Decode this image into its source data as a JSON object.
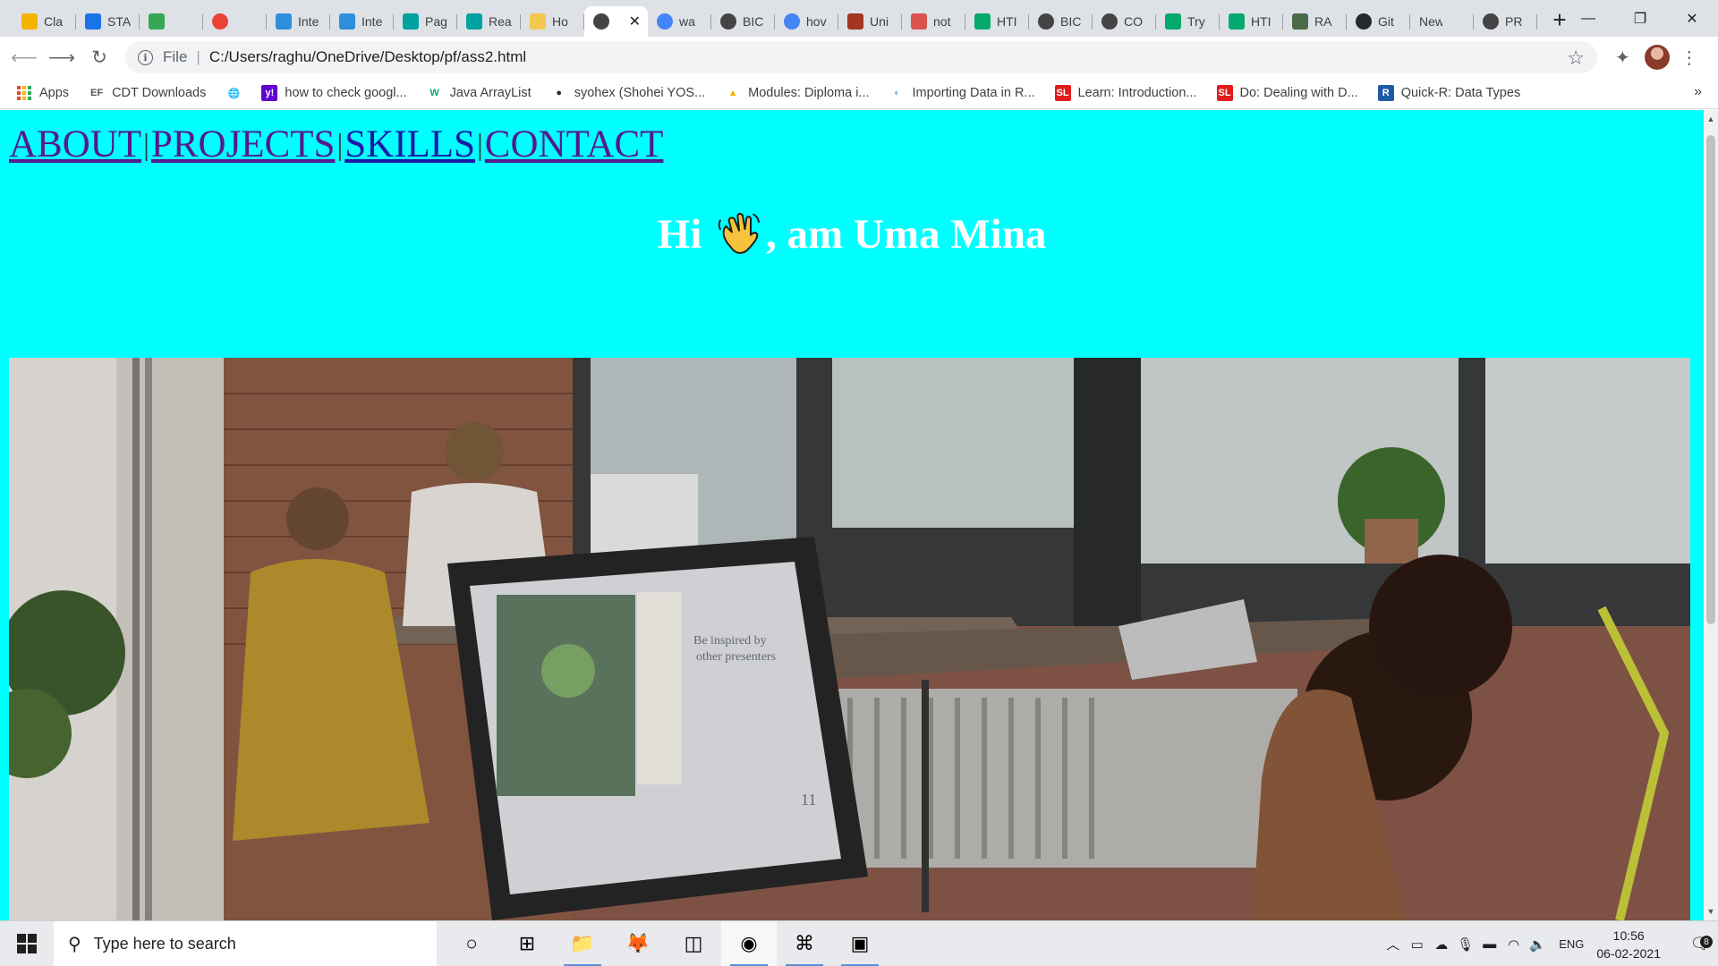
{
  "browser": {
    "tabs": [
      {
        "title": "Cla",
        "icon": "classroom-icon",
        "color": "#f6b400"
      },
      {
        "title": "STA",
        "icon": "contacts-icon",
        "color": "#1a73e8"
      },
      {
        "title": "",
        "icon": "photos-icon",
        "color": "#34a853"
      },
      {
        "title": "",
        "icon": "record-icon",
        "color": "#ea4335"
      },
      {
        "title": "Inte",
        "icon": "is-site-icon",
        "color": "#2b8fdc"
      },
      {
        "title": "Inte",
        "icon": "is-site-icon",
        "color": "#2b8fdc"
      },
      {
        "title": "Pag",
        "icon": "upgrad-icon",
        "color": "#00a2a2"
      },
      {
        "title": "Rea",
        "icon": "upgrad-icon",
        "color": "#00a2a2"
      },
      {
        "title": "Ho",
        "icon": "wave-icon",
        "color": "#f2c94c"
      },
      {
        "title": "",
        "icon": "globe-icon",
        "color": "#444444"
      },
      {
        "title": "wa",
        "icon": "google-icon",
        "color": "#4285f4"
      },
      {
        "title": "BIC",
        "icon": "globe-icon",
        "color": "#444444"
      },
      {
        "title": "hov",
        "icon": "google-icon",
        "color": "#4285f4"
      },
      {
        "title": "Uni",
        "icon": "udemy-icon",
        "color": "#a43523"
      },
      {
        "title": "not",
        "icon": "pdf-icon",
        "color": "#d9534f"
      },
      {
        "title": "HTI",
        "icon": "w3schools-icon",
        "color": "#04aa6d"
      },
      {
        "title": "BIC",
        "icon": "globe-icon",
        "color": "#444444"
      },
      {
        "title": "CO",
        "icon": "globe-icon",
        "color": "#444444"
      },
      {
        "title": "Try",
        "icon": "w3schools-icon",
        "color": "#04aa6d"
      },
      {
        "title": "HTI",
        "icon": "w3schools-icon",
        "color": "#04aa6d"
      },
      {
        "title": "RA",
        "icon": "chip-icon",
        "color": "#4a6b4a"
      },
      {
        "title": "Git",
        "icon": "github-icon",
        "color": "#24292e"
      },
      {
        "title": "New Ta",
        "icon": "",
        "color": "#dee1e6"
      },
      {
        "title": "PR",
        "icon": "globe-icon",
        "color": "#444444"
      }
    ],
    "active_tab_index": 9,
    "new_tab_label": "+",
    "window_controls": {
      "minimize": "—",
      "maximize": "❐",
      "close": "✕"
    },
    "omnibox": {
      "scheme_label": "File",
      "url": "C:/Users/raghu/OneDrive/Desktop/pf/ass2.html"
    },
    "bookmarks": [
      {
        "label": "Apps",
        "icon": "apps-grid-icon"
      },
      {
        "label": "CDT Downloads",
        "icon": "ef-icon",
        "glyph": "EF"
      },
      {
        "label": "",
        "icon": "globe-icon",
        "glyph": "🌐"
      },
      {
        "label": "how to check googl...",
        "icon": "yahoo-icon",
        "glyph": "y!"
      },
      {
        "label": "Java ArrayList",
        "icon": "w3schools-icon",
        "glyph": "W"
      },
      {
        "label": "syohex (Shohei YOS...",
        "icon": "github-icon",
        "glyph": "●"
      },
      {
        "label": "Modules: Diploma i...",
        "icon": "drive-icon",
        "glyph": "▲"
      },
      {
        "label": "Importing Data in R...",
        "icon": "rstudio-icon",
        "glyph": "◐"
      },
      {
        "label": "Learn: Introduction...",
        "icon": "sololearn-icon",
        "glyph": "SL"
      },
      {
        "label": "Do: Dealing with D...",
        "icon": "sololearn-icon",
        "glyph": "SL"
      },
      {
        "label": "Quick-R: Data Types",
        "icon": "r-icon",
        "glyph": "R"
      }
    ]
  },
  "page": {
    "nav": [
      {
        "label": "ABOUT",
        "visited": true
      },
      {
        "label": "PROJECTS",
        "visited": true
      },
      {
        "label": "SKILLS",
        "visited": false
      },
      {
        "label": "CONTACT",
        "visited": true
      }
    ],
    "nav_separator": "|",
    "greeting_start": "Hi",
    "greeting_end": ", am Uma Mina",
    "background_color": "#00ffff",
    "slide": {
      "monitor_caption_1": "Be inspired by",
      "monitor_caption_2": "other presenters",
      "page_number": "11"
    }
  },
  "taskbar": {
    "search_placeholder": "Type here to search",
    "apps": [
      {
        "name": "cortana-icon",
        "glyph": "○",
        "running": false
      },
      {
        "name": "task-view-icon",
        "glyph": "⊞",
        "running": false
      },
      {
        "name": "file-explorer-icon",
        "glyph": "📁",
        "running": true
      },
      {
        "name": "firefox-icon",
        "glyph": "🦊",
        "running": false
      },
      {
        "name": "office-icon",
        "glyph": "◫",
        "running": false
      },
      {
        "name": "chrome-icon",
        "glyph": "◉",
        "running": true
      },
      {
        "name": "vscode-icon",
        "glyph": "⌘",
        "running": true
      },
      {
        "name": "photos-app-icon",
        "glyph": "▣",
        "running": true
      }
    ],
    "language": "ENG",
    "time": "10:56",
    "date": "06-02-2021",
    "notification_count": "8"
  }
}
